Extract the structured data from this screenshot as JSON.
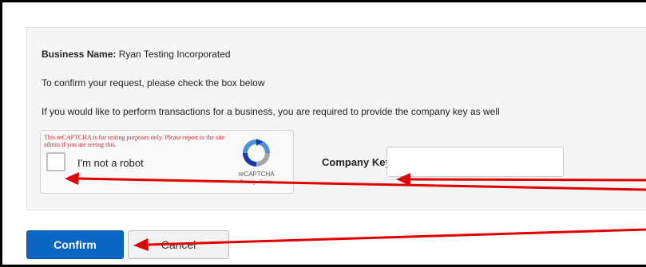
{
  "form": {
    "business_name_label": "Business Name:",
    "business_name_value": "Ryan Testing Incorporated",
    "confirm_instruction": "To confirm your request, please check the box below",
    "company_key_instruction": "If you would like to perform transactions for a business, you are required to provide the company key as well"
  },
  "recaptcha": {
    "test_notice": "This reCAPTCHA is for testing purposes only. Please report to the site admin if you are seeing this.",
    "checkbox_label": "I'm not a robot",
    "brand": "reCAPTCHA",
    "links": "Privacy - Terms"
  },
  "company_key": {
    "label": "Company Key:",
    "value": ""
  },
  "buttons": {
    "confirm_label": "Confirm",
    "cancel_label": "Cancel"
  },
  "colors": {
    "annotation_arrow": "#e00000",
    "confirm_button": "#0a66c2",
    "notice_text": "#d9262e"
  }
}
